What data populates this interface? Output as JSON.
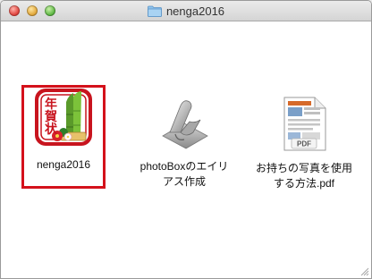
{
  "window": {
    "title": "nenga2016",
    "title_icon": "folder-icon"
  },
  "files": [
    {
      "name": "nenga2016",
      "icon": "nenga-app-icon",
      "icon_text": [
        "年",
        "賀",
        "状"
      ],
      "selected": true
    },
    {
      "name": "photoBoxのエイリ\nアス作成",
      "icon": "applescript-icon"
    },
    {
      "name": "お持ちの写真を使用\nする方法.pdf",
      "icon": "pdf-document-icon",
      "badge": "PDF"
    }
  ],
  "colors": {
    "selection": "#d4111b",
    "nenga_red": "#c8141e"
  }
}
